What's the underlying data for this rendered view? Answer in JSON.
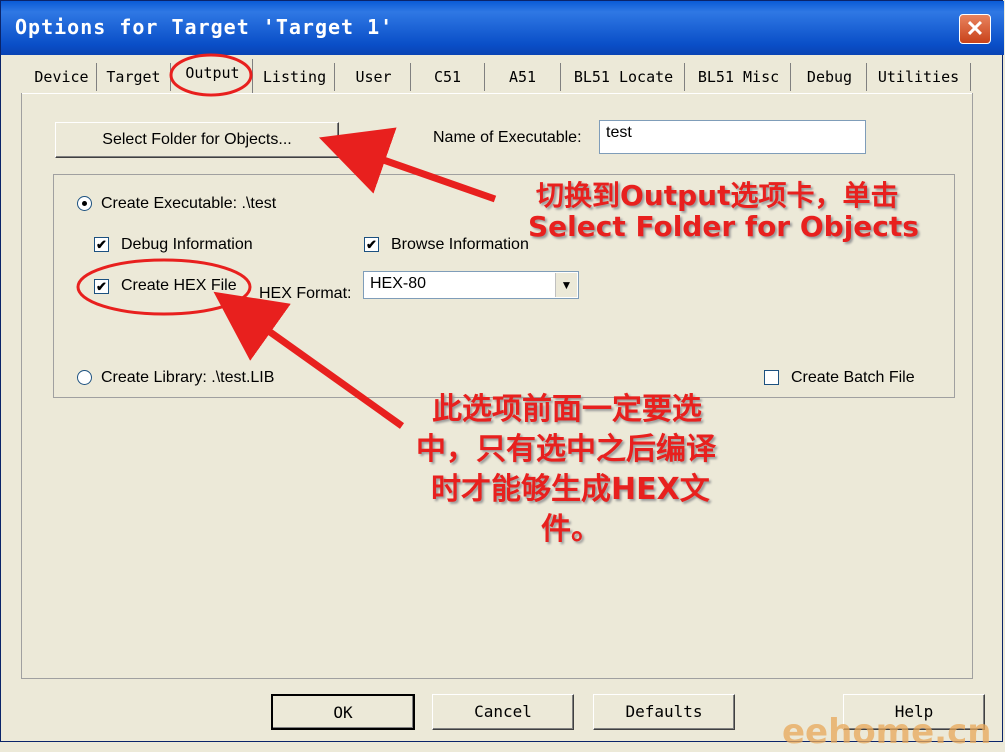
{
  "window": {
    "title": "Options for Target 'Target 1'",
    "close_label": "✕"
  },
  "tabs": [
    {
      "label": "Device"
    },
    {
      "label": "Target"
    },
    {
      "label": "Output",
      "active": true
    },
    {
      "label": "Listing"
    },
    {
      "label": "User"
    },
    {
      "label": "C51"
    },
    {
      "label": "A51"
    },
    {
      "label": "BL51 Locate"
    },
    {
      "label": "BL51 Misc"
    },
    {
      "label": "Debug"
    },
    {
      "label": "Utilities"
    }
  ],
  "output": {
    "select_folder_label": "Select Folder for Objects...",
    "name_of_executable_label": "Name of Executable:",
    "name_of_executable_value": "test",
    "create_executable_label": "Create Executable:  .\\test",
    "create_executable_selected": true,
    "debug_info_label": "Debug Information",
    "debug_info_checked": true,
    "browse_info_label": "Browse Information",
    "browse_info_checked": true,
    "create_hex_label": "Create HEX File",
    "create_hex_checked": true,
    "hex_format_label": "HEX Format:",
    "hex_format_value": "HEX-80",
    "create_library_label": "Create Library:  .\\test.LIB",
    "create_library_selected": false,
    "create_batch_label": "Create Batch File",
    "create_batch_checked": false
  },
  "footer": {
    "ok_label": "OK",
    "cancel_label": "Cancel",
    "defaults_label": "Defaults",
    "help_label": "Help"
  },
  "annotations": {
    "note1_line1": "切换到Output选项卡，单击",
    "note1_line2": "Select  Folder for  Objects",
    "note2_line1": "此选项前面一定要选",
    "note2_line2": "中，只有选中之后编译",
    "note2_line3": "时才能够生成HEX文",
    "note2_line4": "件。",
    "color": "#e8201e"
  },
  "watermark": "eehome.cn",
  "icons": {
    "check": "✔",
    "combo_arrow": "▼"
  }
}
